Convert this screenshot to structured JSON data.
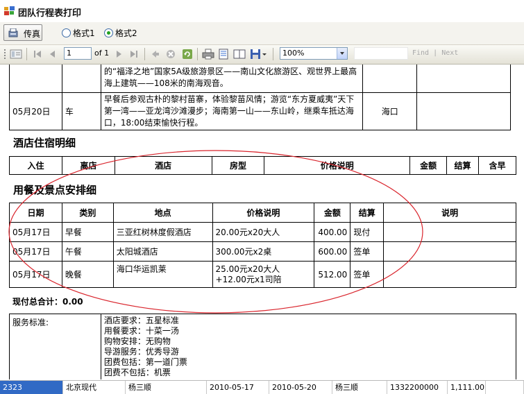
{
  "window": {
    "title": "团队行程表打印"
  },
  "toolbar": {
    "fax_label": "传真",
    "style1_label": "格式1",
    "style2_label": "格式2",
    "selected_style": "格式2"
  },
  "viewer": {
    "page_value": "1",
    "page_of": "of 1",
    "zoom_value": "100%",
    "find_label": "Find",
    "find_next_label": "Next",
    "find_separator": "|"
  },
  "itinerary": {
    "rows": [
      {
        "date": "",
        "transport": "",
        "content": "的“福泽之地”国家5A级旅游景区——南山文化旅游区、观世界上最高海上建筑——108米的南海观音。",
        "stay": ""
      },
      {
        "date": "05月20日",
        "transport": "车",
        "content": "早餐后参观古朴的黎村苗寨，体验黎苗风情；游览“东方夏威夷”天下第一湾——亚龙湾沙滩漫步；海南第一山——东山岭，继乘车抵达海口，18:00结束愉快行程。",
        "stay": "海口"
      }
    ]
  },
  "hotel": {
    "title": "酒店住宿明细",
    "headers": [
      "入住",
      "离店",
      "酒店",
      "房型",
      "价格说明",
      "金额",
      "结算",
      "含早"
    ]
  },
  "meals": {
    "title": "用餐及景点安排细",
    "headers": [
      "日期",
      "类别",
      "地点",
      "价格说明",
      "金额",
      "结算",
      "说明"
    ],
    "rows": [
      {
        "date": "05月17日",
        "type": "早餐",
        "place": "三亚红树林度假酒店",
        "price_line1": "20.00元x20大人",
        "price_line2": "",
        "amount": "400.00",
        "settle": "现付",
        "note": ""
      },
      {
        "date": "05月17日",
        "type": "午餐",
        "place": "太阳城酒店",
        "price_line1": "300.00元x2桌",
        "price_line2": "",
        "amount": "600.00",
        "settle": "签单",
        "note": ""
      },
      {
        "date": "05月17日",
        "type": "晚餐",
        "place": "海口华运凯莱",
        "price_line1": "25.00元x20大人",
        "price_line2": "+12.00元x1司陪",
        "amount": "512.00",
        "settle": "签单",
        "note": ""
      }
    ]
  },
  "total": {
    "label": "现付总合计：0.00"
  },
  "service": {
    "label": "服务标准:",
    "lines": [
      "酒店要求：五星标准",
      "用餐要求：十菜一汤",
      "购物安排：无购物",
      "导游服务：优秀导游",
      "团费包括：第一道门票",
      "团费不包括：机票"
    ]
  },
  "statusbar": {
    "cells": [
      "2323",
      "北京现代",
      "杨三顺",
      "2010-05-17",
      "2010-05-20",
      "杨三顺",
      "1332200000",
      "1,111.00"
    ]
  },
  "colors": {
    "annotation_ellipse": "#d9232b",
    "selected_row": "#316ac5"
  }
}
